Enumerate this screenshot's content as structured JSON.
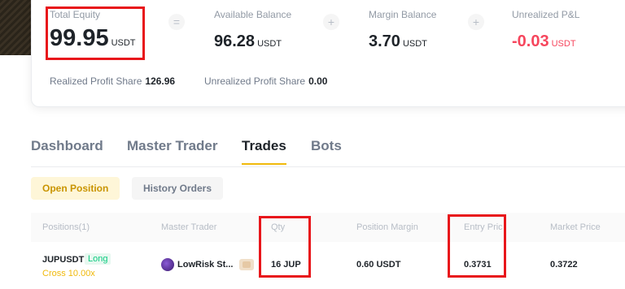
{
  "summary": {
    "total_equity": {
      "label": "Total Equity",
      "value": "99.95",
      "unit": "USDT"
    },
    "available_balance": {
      "label": "Available Balance",
      "value": "96.28",
      "unit": "USDT"
    },
    "margin_balance": {
      "label": "Margin Balance",
      "value": "3.70",
      "unit": "USDT"
    },
    "unrealized_pnl": {
      "label": "Unrealized P&L",
      "value": "-0.03",
      "unit": "USDT"
    },
    "ops": [
      "=",
      "+",
      "+"
    ],
    "realized_profit_share": {
      "label": "Realized Profit Share",
      "value": "126.96"
    },
    "unrealized_profit_share": {
      "label": "Unrealized Profit Share",
      "value": "0.00"
    }
  },
  "tabs": [
    {
      "label": "Dashboard",
      "active": false
    },
    {
      "label": "Master Trader",
      "active": false
    },
    {
      "label": "Trades",
      "active": true
    },
    {
      "label": "Bots",
      "active": false
    }
  ],
  "subtabs": {
    "open_position": "Open Position",
    "history_orders": "History Orders"
  },
  "table": {
    "headers": [
      "Positions(1)",
      "Master Trader",
      "Qty",
      "Position Margin",
      "Entry Pric",
      "Market Price"
    ],
    "rows": [
      {
        "symbol": "JUPUSDT",
        "side": "Long",
        "margin_mode": "Cross 10.00x",
        "master_trader": "LowRisk St...",
        "qty": "16 JUP",
        "position_margin": "0.60 USDT",
        "entry_price": "0.3731",
        "market_price": "0.3722"
      }
    ]
  },
  "colors": {
    "accent": "#f0b90b",
    "negative": "#f6465d",
    "positive": "#0ecb81",
    "annotation": "#e8161b"
  }
}
